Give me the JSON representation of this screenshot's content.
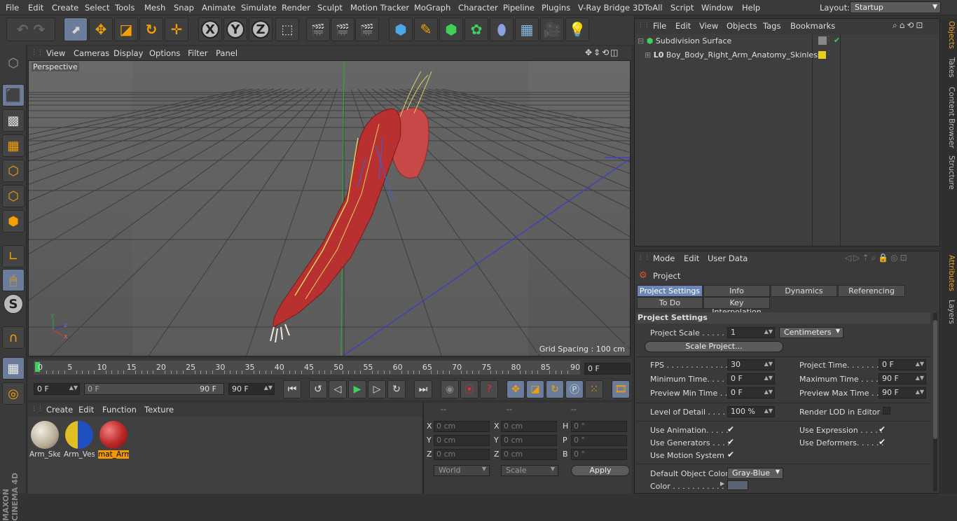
{
  "menubar": {
    "items": [
      "File",
      "Edit",
      "Create",
      "Select",
      "Tools",
      "Mesh",
      "Snap",
      "Animate",
      "Simulate",
      "Render",
      "Sculpt",
      "Motion Tracker",
      "MoGraph",
      "Character",
      "Pipeline",
      "Plugins",
      "V-Ray Bridge",
      "3DToAll",
      "Script",
      "Window",
      "Help"
    ],
    "layout_label": "Layout:",
    "layout_value": "Startup"
  },
  "toolbar": {
    "axis_x": "X",
    "axis_y": "Y",
    "axis_z": "Z"
  },
  "viewport_menu": [
    "View",
    "Cameras",
    "Display",
    "Options",
    "Filter",
    "Panel"
  ],
  "viewport": {
    "label": "Perspective",
    "grid_spacing": "Grid Spacing : 100 cm"
  },
  "timeline": {
    "ticks": [
      "0",
      "5",
      "10",
      "15",
      "20",
      "25",
      "30",
      "35",
      "40",
      "45",
      "50",
      "55",
      "60",
      "65",
      "70",
      "75",
      "80",
      "85",
      "90"
    ],
    "current": "0 F"
  },
  "transport": {
    "start": "0 F",
    "range_start": "0 F",
    "range_end": "90 F",
    "end": "90 F"
  },
  "material_menu": [
    "Create",
    "Edit",
    "Function",
    "Texture"
  ],
  "materials": [
    {
      "name": "Arm_Ske",
      "selected": false
    },
    {
      "name": "Arm_Ves",
      "selected": false
    },
    {
      "name": "mat_Arm",
      "selected": true
    }
  ],
  "coords": {
    "headers": [
      "--",
      "--",
      "--"
    ],
    "rows": [
      {
        "a": "X",
        "av": "0 cm",
        "b": "X",
        "bv": "0 cm",
        "c": "H",
        "cv": "0 °"
      },
      {
        "a": "Y",
        "av": "0 cm",
        "b": "Y",
        "bv": "0 cm",
        "c": "P",
        "cv": "0 °"
      },
      {
        "a": "Z",
        "av": "0 cm",
        "b": "Z",
        "bv": "0 cm",
        "c": "B",
        "cv": "0 °"
      }
    ],
    "space": "World",
    "mode": "Scale",
    "apply": "Apply"
  },
  "object_menu": [
    "File",
    "Edit",
    "View",
    "Objects",
    "Tags",
    "Bookmarks"
  ],
  "objects": [
    {
      "name": "Subdivision Surface"
    },
    {
      "name": "Boy_Body_Right_Arm_Anatomy_Skinless"
    }
  ],
  "right_tabs": [
    "Objects",
    "Takes",
    "Content Browser",
    "Structure",
    "Attributes",
    "Layers"
  ],
  "attr_menu": [
    "Mode",
    "Edit",
    "User Data"
  ],
  "attributes": {
    "header": "Project",
    "tabs_row1": [
      "Project Settings",
      "Info",
      "Dynamics",
      "Referencing"
    ],
    "tabs_row2": [
      "To Do",
      "Key Interpolation"
    ],
    "section": "Project Settings",
    "project_scale_label": "Project Scale . . . . . .",
    "project_scale_value": "1",
    "project_scale_unit": "Centimeters",
    "scale_project_btn": "Scale Project...",
    "fps_label": "FPS . . . . . . . . . . . . . .",
    "fps_value": "30",
    "project_time_label": "Project Time. . . . . . .",
    "project_time_value": "0 F",
    "min_time_label": "Minimum Time. . . . . .",
    "min_time_value": "0 F",
    "max_time_label": "Maximum Time . . . . .",
    "max_time_value": "90 F",
    "prev_min_label": "Preview Min Time . .",
    "prev_min_value": "0 F",
    "prev_max_label": "Preview Max Time . . .",
    "prev_max_value": "90 F",
    "lod_label": "Level of Detail . . . . .",
    "lod_value": "100 %",
    "render_lod_label": "Render LOD in Editor",
    "use_anim_label": "Use Animation. . . . .",
    "use_expr_label": "Use Expression . . . . .",
    "use_gen_label": "Use Generators . . . .",
    "use_def_label": "Use Deformers. . . . . .",
    "use_motion_label": "Use Motion System",
    "def_color_label": "Default Object Color",
    "def_color_value": "Gray-Blue",
    "color_label": "Color . . . . . . . . . . .",
    "check": "✔"
  }
}
